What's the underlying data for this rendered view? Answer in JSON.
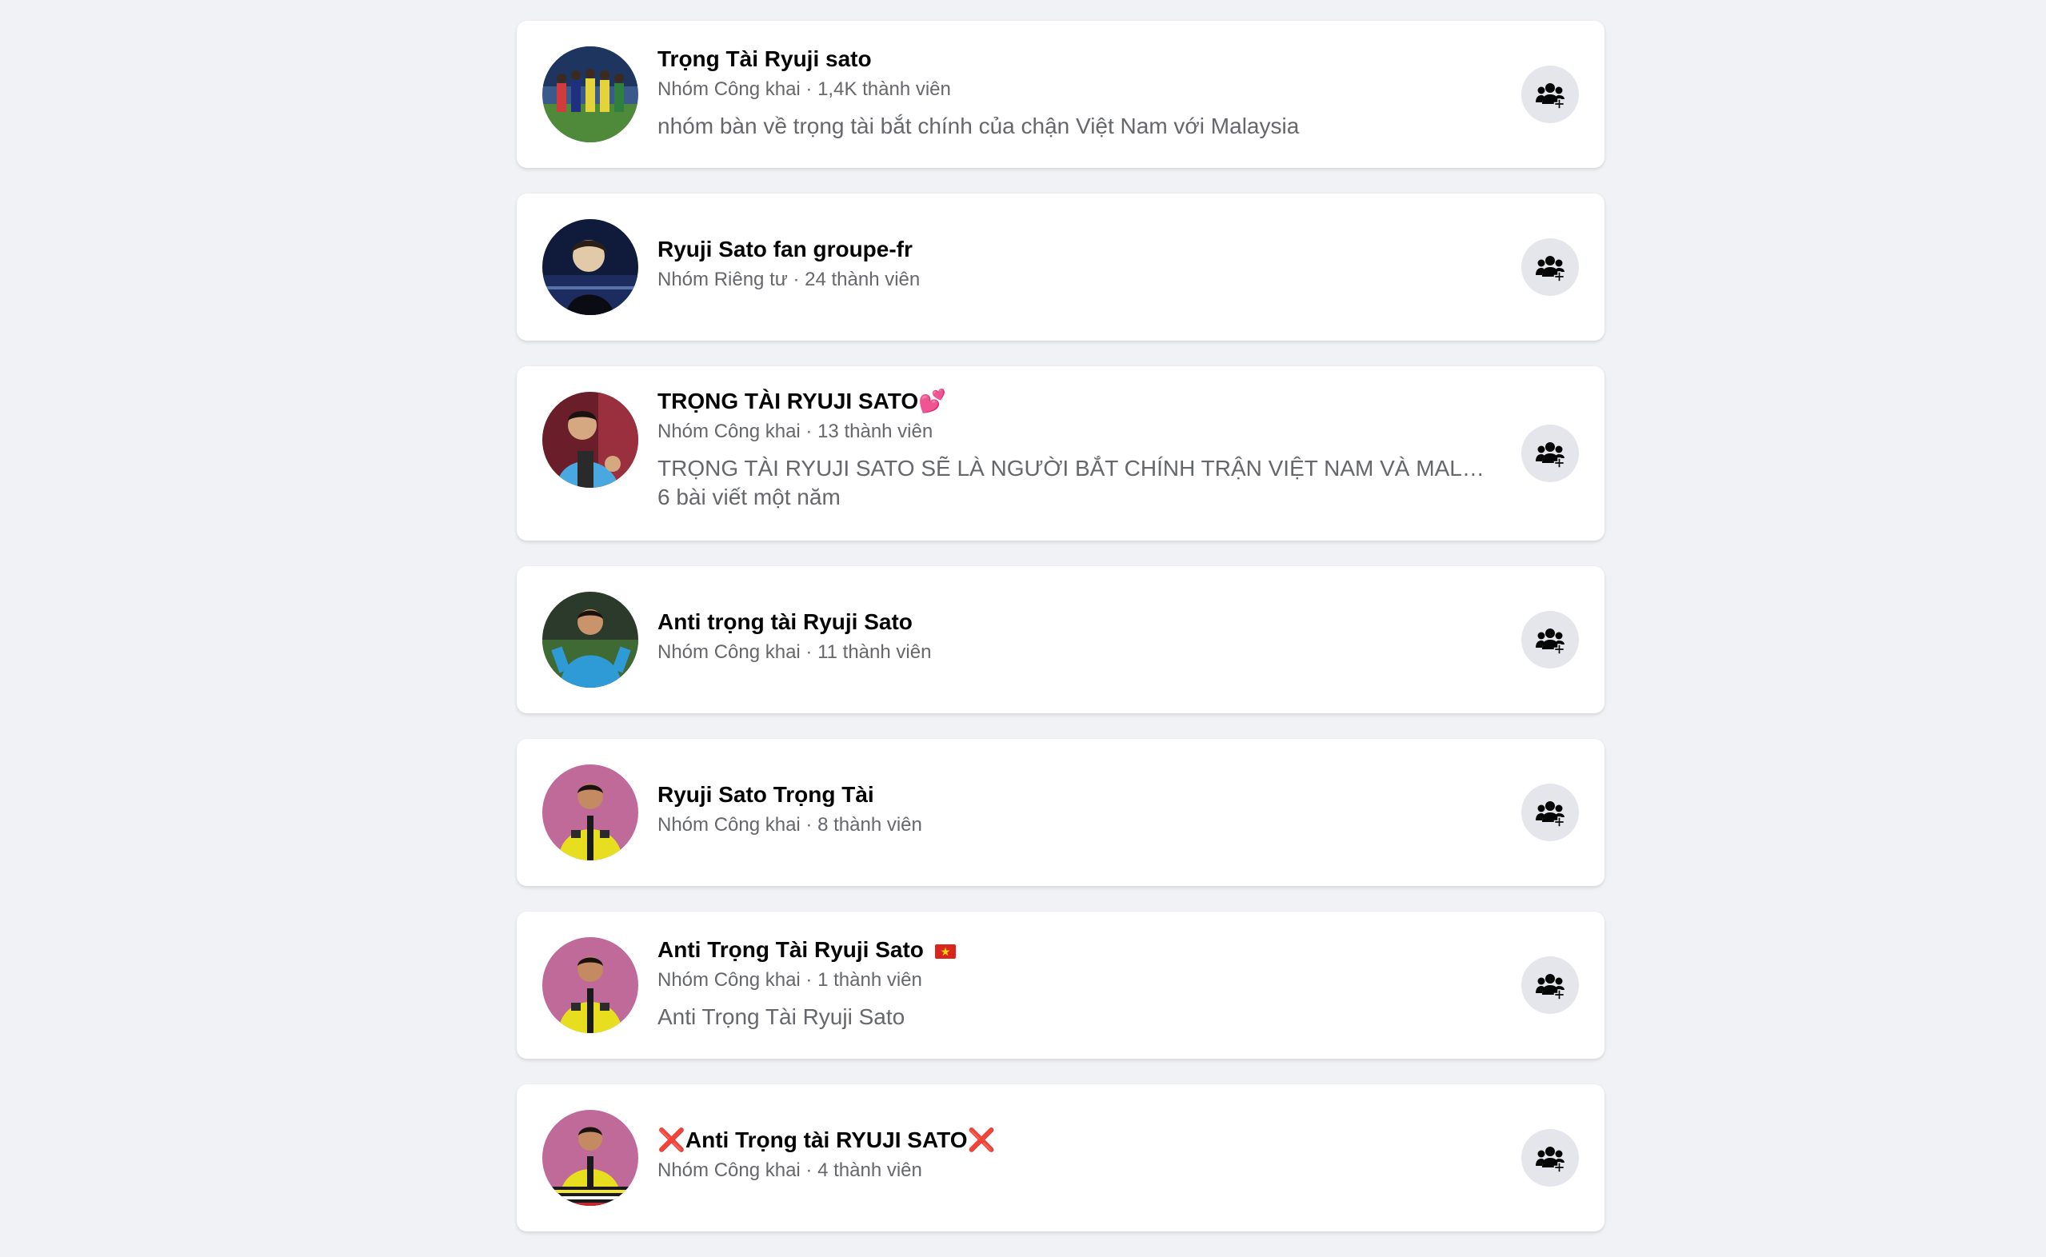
{
  "groups": [
    {
      "name": "Trọng Tài Ryuji sato",
      "meta": "Nhóm Công khai · 1,4K thành viên",
      "description": "nhóm bàn về trọng tài bắt chính của chận Việt Nam với Malaysia",
      "description2": ""
    },
    {
      "name": "Ryuji Sato fan groupe-fr",
      "meta": "Nhóm Riêng tư · 24 thành viên",
      "description": "",
      "description2": ""
    },
    {
      "name": "TRỌNG TÀI RYUJI SATO💕",
      "meta": "Nhóm Công khai · 13 thành viên",
      "description": "TRỌNG TÀI RYUJI SATO SẼ LÀ NGƯỜI BẮT CHÍNH TRẬN VIỆT NAM VÀ MALAYSIA",
      "description2": "6 bài viết một năm"
    },
    {
      "name": "Anti trọng tài Ryuji Sato",
      "meta": "Nhóm Công khai · 11 thành viên",
      "description": "",
      "description2": ""
    },
    {
      "name": "Ryuji Sato Trọng Tài",
      "meta": "Nhóm Công khai · 8 thành viên",
      "description": "",
      "description2": ""
    },
    {
      "name": "Anti Trọng Tài Ryuji Sato",
      "meta": "Nhóm Công khai · 1 thành viên",
      "description": "Anti Trọng Tài Ryuji Sato",
      "description2": ""
    },
    {
      "name": "❌Anti Trọng tài RYUJI SATO❌",
      "meta": "Nhóm Công khai · 4 thành viên",
      "description": "",
      "description2": ""
    }
  ],
  "icons": {
    "join": "group-add-icon"
  },
  "colors": {
    "background": "#f0f2f5",
    "card": "#ffffff",
    "button": "#e4e6eb",
    "secondary_text": "#65676b",
    "primary_text": "#050505"
  }
}
